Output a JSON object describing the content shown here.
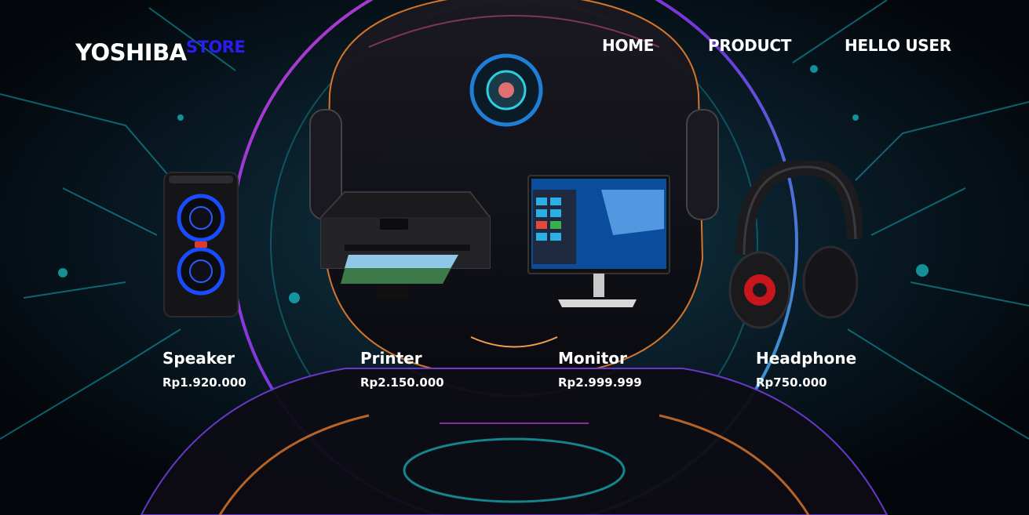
{
  "brand": {
    "main": "YOSHIBA",
    "accent": "STORE"
  },
  "nav": {
    "home": "HOME",
    "product": "PRODUCT",
    "user": "HELLO USER"
  },
  "products": [
    {
      "name": "Speaker",
      "price": "Rp1.920.000",
      "icon": "speaker-image"
    },
    {
      "name": "Printer",
      "price": "Rp2.150.000",
      "icon": "printer-image"
    },
    {
      "name": "Monitor",
      "price": "Rp2.999.999",
      "icon": "monitor-image"
    },
    {
      "name": "Headphone",
      "price": "Rp750.000",
      "icon": "headphone-image"
    }
  ],
  "colors": {
    "accent": "#2b1cf0",
    "background": "#04070c",
    "neon_cyan": "#13c6d6",
    "neon_magenta": "#c03ad8",
    "neon_orange": "#e07a2a"
  }
}
